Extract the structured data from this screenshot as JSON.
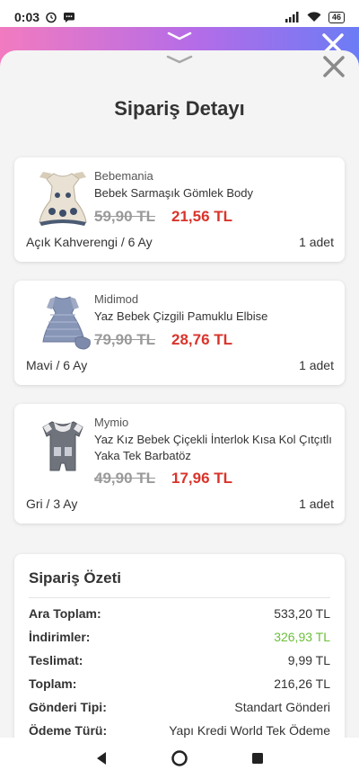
{
  "status_bar": {
    "time": "0:03",
    "battery": "46"
  },
  "sheet": {
    "title": "Sipariş Detayı"
  },
  "items": [
    {
      "brand": "Bebemania",
      "name": "Bebek Sarmaşık Gömlek Body",
      "old_price": "59,90 TL",
      "new_price": "21,56 TL",
      "variant": "Açık Kahverengi / 6 Ay",
      "quantity": "1 adet"
    },
    {
      "brand": "Midimod",
      "name": "Yaz Bebek Çizgili Pamuklu Elbise",
      "old_price": "79,90 TL",
      "new_price": "28,76 TL",
      "variant": "Mavi / 6 Ay",
      "quantity": "1 adet"
    },
    {
      "brand": "Mymio",
      "name": "Yaz Kız Bebek Çiçekli İnterlok Kısa Kol Çıtçıtlı Yaka Tek Barbatöz",
      "old_price": "49,90 TL",
      "new_price": "17,96 TL",
      "variant": "Gri / 3 Ay",
      "quantity": "1 adet"
    }
  ],
  "summary": {
    "title": "Sipariş Özeti",
    "rows": [
      {
        "label": "Ara Toplam:",
        "value": "533,20 TL"
      },
      {
        "label": "İndirimler:",
        "value": "326,93 TL"
      },
      {
        "label": "Teslimat:",
        "value": "9,99 TL"
      },
      {
        "label": "Toplam:",
        "value": "216,26 TL"
      },
      {
        "label": "Gönderi Tipi:",
        "value": "Standart Gönderi"
      },
      {
        "label": "Ödeme Türü:",
        "value": "Yapı Kredi World Tek Ödeme"
      }
    ]
  },
  "colors": {
    "discount_price": "#d9342b",
    "discount_total": "#6bbf3a",
    "gradient_start": "#f27bc0",
    "gradient_end": "#6b7cf5"
  },
  "icons": {
    "alarm": "alarm-icon",
    "message": "message-icon",
    "signal": "signal-icon",
    "wifi": "wifi-icon",
    "close": "close-icon",
    "handle": "chevron-down-icon",
    "nav_back": "back-triangle-icon",
    "nav_home": "home-circle-icon",
    "nav_recents": "recents-square-icon"
  }
}
